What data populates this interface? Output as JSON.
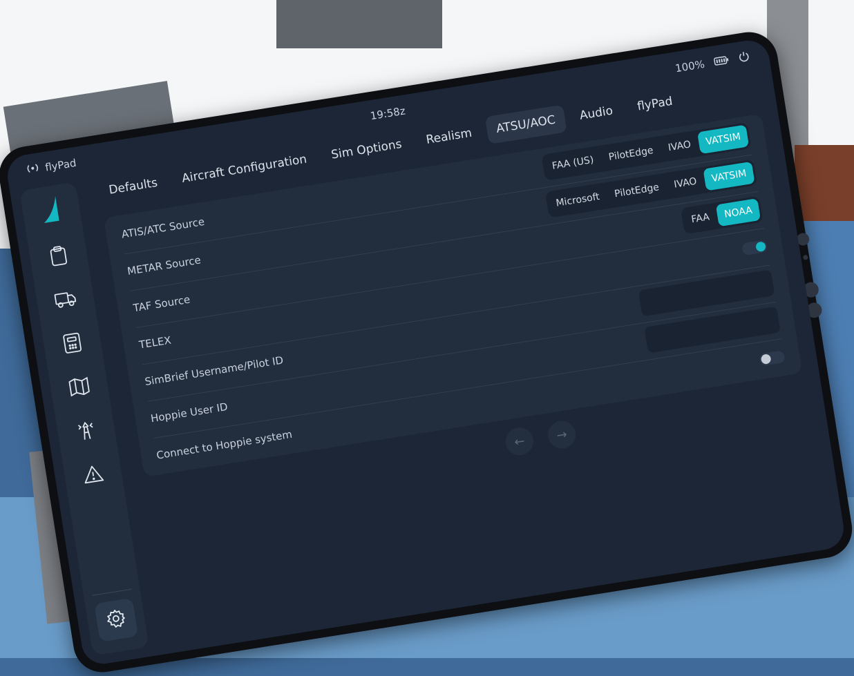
{
  "status_bar": {
    "app_name": "flyPad",
    "time": "19:58z",
    "battery": "100%"
  },
  "tabs": [
    {
      "label": "Defaults"
    },
    {
      "label": "Aircraft Configuration"
    },
    {
      "label": "Sim Options"
    },
    {
      "label": "Realism"
    },
    {
      "label": "ATSU/AOC",
      "active": true
    },
    {
      "label": "Audio"
    },
    {
      "label": "flyPad"
    }
  ],
  "settings": {
    "atis_atc_source": {
      "label": "ATIS/ATC Source",
      "options": [
        "FAA (US)",
        "PilotEdge",
        "IVAO",
        "VATSIM"
      ],
      "selected": "VATSIM"
    },
    "metar_source": {
      "label": "METAR Source",
      "options": [
        "Microsoft",
        "PilotEdge",
        "IVAO",
        "VATSIM"
      ],
      "selected": "VATSIM"
    },
    "taf_source": {
      "label": "TAF Source",
      "options": [
        "FAA",
        "NOAA"
      ],
      "selected": "NOAA"
    },
    "telex": {
      "label": "TELEX",
      "enabled": true
    },
    "simbrief": {
      "label": "SimBrief Username/Pilot ID",
      "value": ""
    },
    "hoppie_user": {
      "label": "Hoppie User ID",
      "value": ""
    },
    "hoppie_connect": {
      "label": "Connect to Hoppie system",
      "enabled": false
    }
  },
  "pager": {
    "prev": "←",
    "next": "→"
  },
  "sidebar": {
    "items": [
      "dashboard-logo",
      "checklist-icon",
      "ground-truck-icon",
      "calculator-icon",
      "map-icon",
      "atc-tower-icon",
      "warning-icon"
    ],
    "settings_icon": "gear-icon"
  },
  "colors": {
    "accent": "#14b8c2",
    "screen_bg": "#1c2636",
    "card_bg": "#222d3d"
  }
}
